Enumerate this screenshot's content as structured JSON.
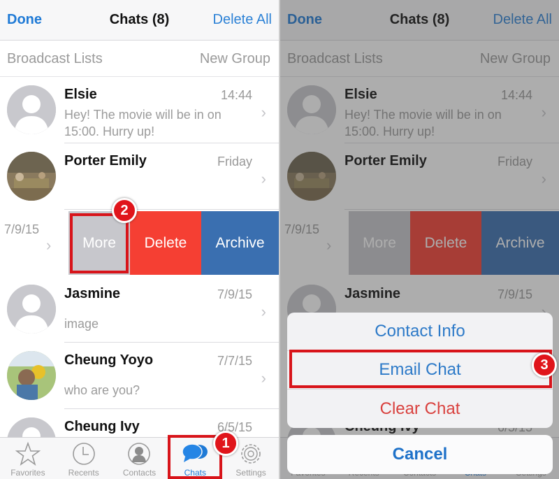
{
  "navbar": {
    "left_button": "Done",
    "title": "Chats (8)",
    "right_button": "Delete All"
  },
  "subbar": {
    "broadcast": "Broadcast Lists",
    "new_group": "New Group"
  },
  "chats": [
    {
      "name": "Elsie",
      "time": "14:44",
      "message": "Hey! The movie will be in on 15:00. Hurry up!",
      "avatar": "default"
    },
    {
      "name": "Porter Emily",
      "time": "Friday",
      "message": "",
      "avatar": "photo"
    },
    {
      "name": "",
      "time": "7/9/15",
      "message": "",
      "avatar": "swiped"
    },
    {
      "name": "Jasmine",
      "time": "7/9/15",
      "message": "image",
      "avatar": "default"
    },
    {
      "name": "Cheung Yoyo",
      "time": "7/7/15",
      "message": "who are you?",
      "avatar": "photo"
    },
    {
      "name": "Cheung Ivy",
      "time": "6/5/15",
      "message": "",
      "avatar": "default"
    }
  ],
  "swipe_actions": {
    "more": "More",
    "delete": "Delete",
    "archive": "Archive"
  },
  "tabbar": [
    {
      "label": "Favorites",
      "icon": "star-icon"
    },
    {
      "label": "Recents",
      "icon": "clock-icon"
    },
    {
      "label": "Contacts",
      "icon": "contact-icon"
    },
    {
      "label": "Chats",
      "icon": "chat-bubbles-icon",
      "active": true
    },
    {
      "label": "Settings",
      "icon": "gear-icon"
    }
  ],
  "action_sheet": {
    "options": [
      "Contact Info",
      "Email Chat",
      "Clear Chat"
    ],
    "cancel": "Cancel"
  },
  "annotations": {
    "step1": "1",
    "step2": "2",
    "step3": "3"
  },
  "colors": {
    "accent": "#1f7ad6",
    "delete": "#f53f33",
    "archive": "#3a6fb0",
    "more": "#c7c7cc",
    "annotation": "#d8141a"
  }
}
